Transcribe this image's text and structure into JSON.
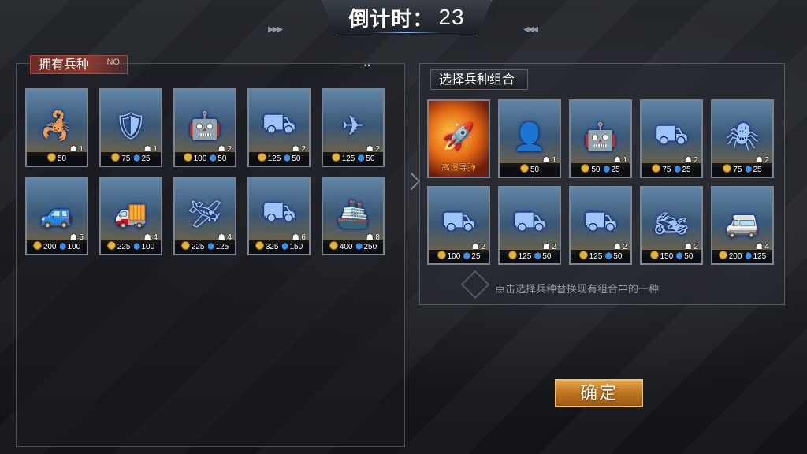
{
  "header": {
    "timer_label": "倒计时：",
    "timer_value": "23"
  },
  "owned_panel": {
    "title": "拥有兵种",
    "badge": "NO.",
    "units": [
      {
        "icon": "scorpion-mech-icon",
        "pop": "1",
        "gold": "50",
        "crystal": ""
      },
      {
        "icon": "armored-soldier-icon",
        "pop": "1",
        "gold": "75",
        "crystal": "25"
      },
      {
        "icon": "heavy-mech-icon",
        "pop": "2",
        "gold": "100",
        "crystal": "50"
      },
      {
        "icon": "hover-tank-icon",
        "pop": "2",
        "gold": "125",
        "crystal": "50"
      },
      {
        "icon": "drone-icon",
        "pop": "2",
        "gold": "125",
        "crystal": "50"
      },
      {
        "icon": "apc-icon",
        "pop": "5",
        "gold": "200",
        "crystal": "100"
      },
      {
        "icon": "armored-truck-icon",
        "pop": "4",
        "gold": "225",
        "crystal": "100"
      },
      {
        "icon": "fighter-jet-icon",
        "pop": "4",
        "gold": "225",
        "crystal": "125"
      },
      {
        "icon": "artillery-tank-icon",
        "pop": "6",
        "gold": "325",
        "crystal": "150"
      },
      {
        "icon": "battleship-icon",
        "pop": "8",
        "gold": "400",
        "crystal": "250"
      }
    ]
  },
  "select_panel": {
    "title": "选择兵种组合",
    "missile_name": "高爆导弹",
    "units": [
      {
        "icon": "commando-icon",
        "pop": "1",
        "gold": "50",
        "crystal": ""
      },
      {
        "icon": "power-armor-icon",
        "pop": "1",
        "gold": "50",
        "crystal": "25"
      },
      {
        "icon": "light-tank-icon",
        "pop": "2",
        "gold": "75",
        "crystal": "25"
      },
      {
        "icon": "spider-bot-icon",
        "pop": "2",
        "gold": "75",
        "crystal": "25"
      },
      {
        "icon": "rocket-launcher-icon",
        "pop": "2",
        "gold": "100",
        "crystal": "25"
      },
      {
        "icon": "laser-tank-icon",
        "pop": "2",
        "gold": "125",
        "crystal": "50"
      },
      {
        "icon": "twin-cannon-tank-icon",
        "pop": "2",
        "gold": "125",
        "crystal": "50"
      },
      {
        "icon": "mech-rider-icon",
        "pop": "2",
        "gold": "150",
        "crystal": "50"
      },
      {
        "icon": "armored-van-icon",
        "pop": "4",
        "gold": "200",
        "crystal": "125"
      }
    ],
    "hint": "点击选择兵种替换现有组合中的一种"
  },
  "confirm_label": "确定",
  "colors": {
    "accent_gold": "#e4b43a",
    "crystal_blue": "#3c8fe8",
    "title_red": "#8b3a2f"
  }
}
